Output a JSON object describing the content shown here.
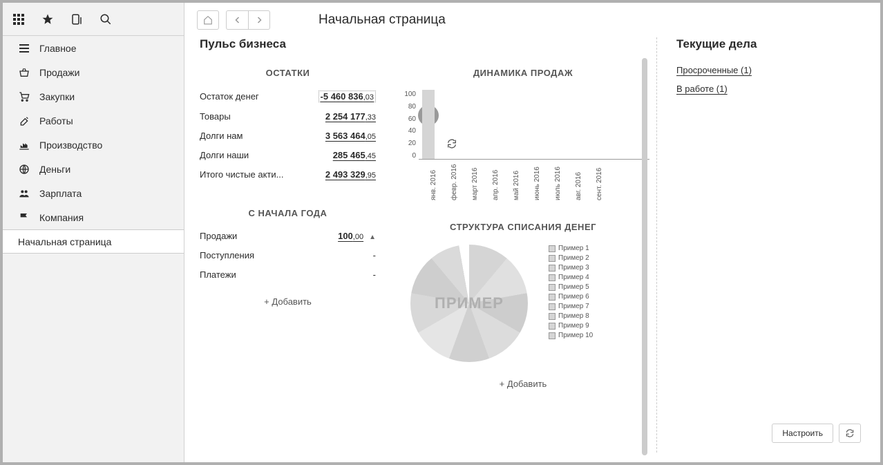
{
  "page_title": "Начальная страница",
  "sidebar": {
    "items": [
      {
        "label": "Главное",
        "icon": "menu"
      },
      {
        "label": "Продажи",
        "icon": "basket"
      },
      {
        "label": "Закупки",
        "icon": "cart"
      },
      {
        "label": "Работы",
        "icon": "tools"
      },
      {
        "label": "Производство",
        "icon": "factory"
      },
      {
        "label": "Деньги",
        "icon": "globe"
      },
      {
        "label": "Зарплата",
        "icon": "people"
      },
      {
        "label": "Компания",
        "icon": "flag"
      }
    ],
    "active_item": "Начальная страница"
  },
  "pulse_title": "Пульс бизнеса",
  "balances": {
    "header": "ОСТАТКИ",
    "rows": [
      {
        "label": "Остаток денег",
        "value": "-5 460 836",
        "dec": ",03",
        "neg": true
      },
      {
        "label": "Товары",
        "value": "2 254 177",
        "dec": ",33"
      },
      {
        "label": "Долги нам",
        "value": "3 563 464",
        "dec": ",05"
      },
      {
        "label": "Долги наши",
        "value": "285 465",
        "dec": ",45"
      },
      {
        "label": "Итого чистые акти...",
        "value": "2 493 329",
        "dec": ",95"
      }
    ]
  },
  "ytd": {
    "header": "С НАЧАЛА ГОДА",
    "rows": [
      {
        "label": "Продажи",
        "value": "100",
        "dec": ",00",
        "arrow": true
      },
      {
        "label": "Поступления",
        "value": "-"
      },
      {
        "label": "Платежи",
        "value": "-"
      }
    ],
    "add_label": "+ Добавить"
  },
  "sales_chart": {
    "header": "ДИНАМИКА ПРОДАЖ"
  },
  "pie_chart": {
    "header": "СТРУКТУРА СПИСАНИЯ ДЕНЕГ",
    "watermark": "ПРИМЕР",
    "legend": [
      "Пример 1",
      "Пример 2",
      "Пример 3",
      "Пример 4",
      "Пример 5",
      "Пример 6",
      "Пример 7",
      "Пример 8",
      "Пример 9",
      "Пример 10"
    ],
    "add_label": "+ Добавить"
  },
  "tasks": {
    "header": "Текущие дела",
    "links": [
      "Просроченные (1)",
      "В работе (1)"
    ]
  },
  "actions": {
    "configure": "Настроить"
  },
  "chart_data": [
    {
      "type": "bar",
      "title": "ДИНАМИКА ПРОДАЖ",
      "categories": [
        "янв. 2016",
        "февр. 2016",
        "март 2016",
        "апр. 2016",
        "май 2016",
        "июнь 2016",
        "июль 2016",
        "авг. 2016",
        "сент. 2016"
      ],
      "values": [
        100,
        0,
        0,
        0,
        0,
        0,
        0,
        0,
        0
      ],
      "ylim": [
        0,
        100
      ],
      "yticks": [
        0,
        20,
        40,
        60,
        80,
        100
      ]
    },
    {
      "type": "pie",
      "title": "СТРУКТУРА СПИСАНИЯ ДЕНЕГ",
      "series": [
        {
          "name": "Пример 1",
          "value": 10
        },
        {
          "name": "Пример 2",
          "value": 10
        },
        {
          "name": "Пример 3",
          "value": 10
        },
        {
          "name": "Пример 4",
          "value": 10
        },
        {
          "name": "Пример 5",
          "value": 10
        },
        {
          "name": "Пример 6",
          "value": 10
        },
        {
          "name": "Пример 7",
          "value": 10
        },
        {
          "name": "Пример 8",
          "value": 10
        },
        {
          "name": "Пример 9",
          "value": 10
        },
        {
          "name": "Пример 10",
          "value": 10
        }
      ]
    }
  ]
}
